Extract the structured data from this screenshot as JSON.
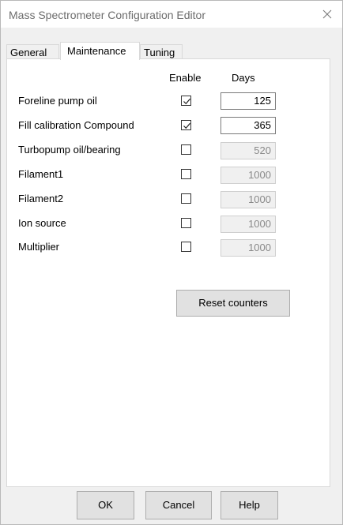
{
  "window": {
    "title": "Mass Spectrometer Configuration Editor",
    "close_icon": "close-icon"
  },
  "tabs": [
    {
      "label": "General",
      "active": false
    },
    {
      "label": "Maintenance",
      "active": true
    },
    {
      "label": "Tuning",
      "active": false
    }
  ],
  "maintenance": {
    "enable_header": "Enable",
    "days_header": "Days",
    "items": [
      {
        "label": "Foreline pump oil",
        "enabled": true,
        "days": "125"
      },
      {
        "label": "Fill calibration Compound",
        "enabled": true,
        "days": "365"
      },
      {
        "label": "Turbopump oil/bearing",
        "enabled": false,
        "days": "520"
      },
      {
        "label": "Filament1",
        "enabled": false,
        "days": "1000"
      },
      {
        "label": "Filament2",
        "enabled": false,
        "days": "1000"
      },
      {
        "label": "Ion source",
        "enabled": false,
        "days": "1000"
      },
      {
        "label": "Multiplier",
        "enabled": false,
        "days": "1000"
      }
    ],
    "reset_label": "Reset counters"
  },
  "buttons": {
    "ok": "OK",
    "cancel": "Cancel",
    "help": "Help"
  }
}
